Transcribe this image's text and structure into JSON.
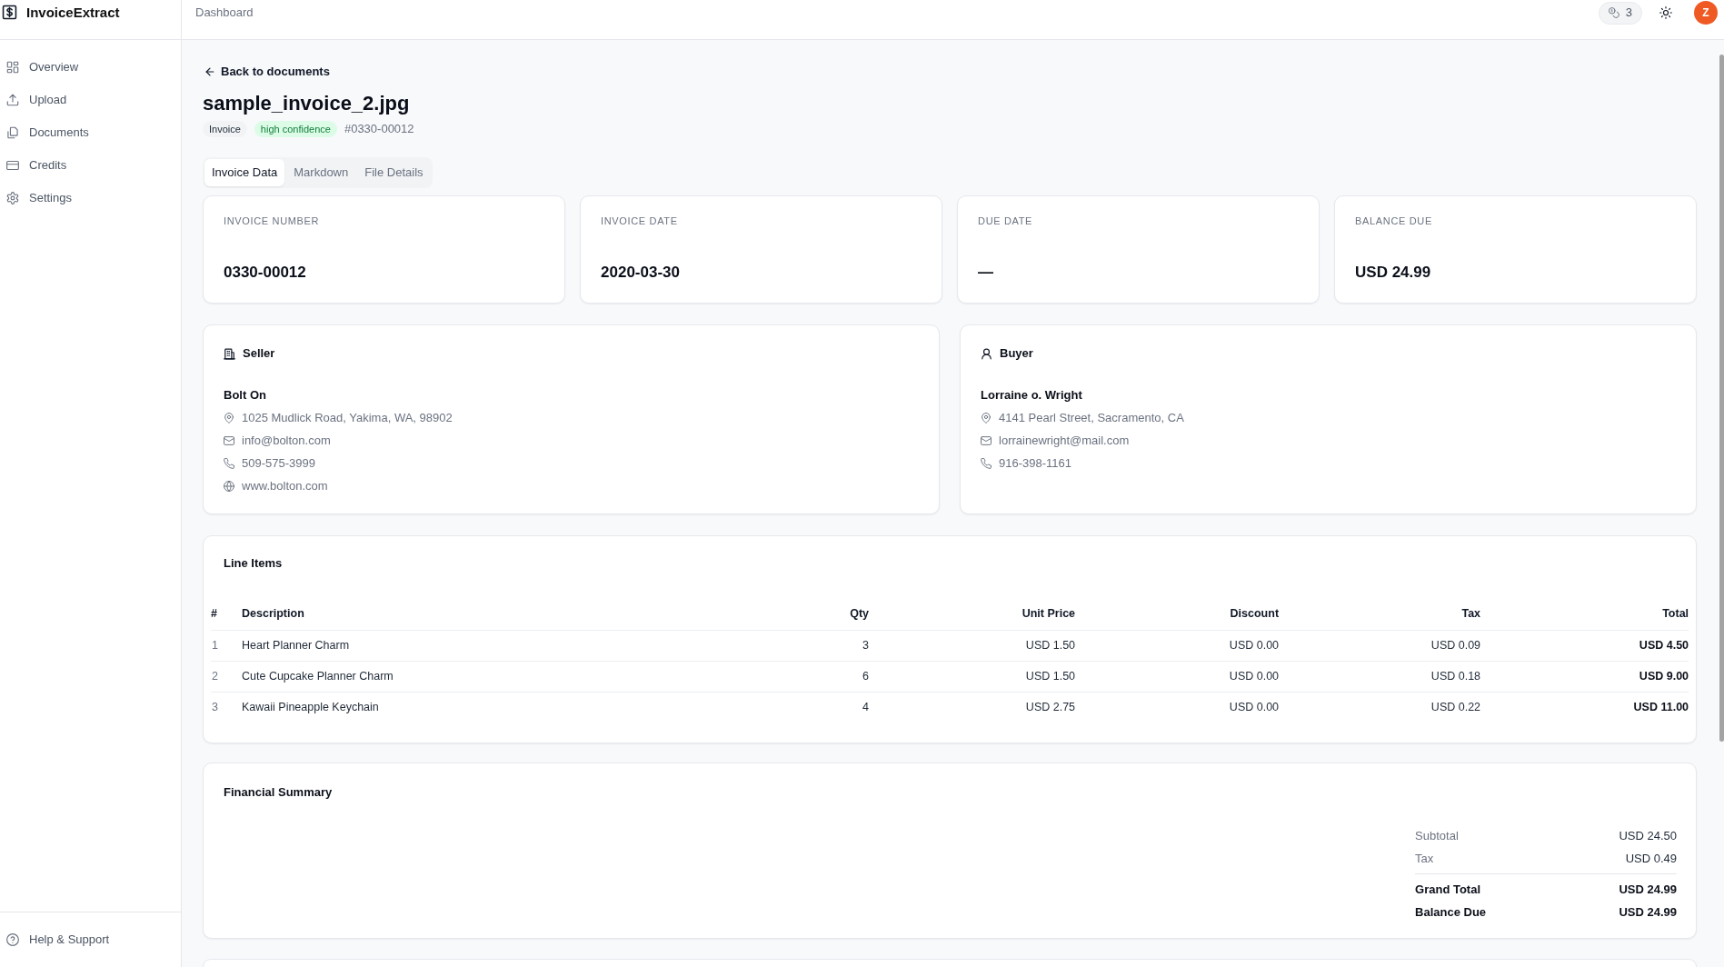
{
  "app": {
    "name": "InvoiceExtract"
  },
  "sidebar": {
    "items": [
      {
        "label": "Overview",
        "selected": false
      },
      {
        "label": "Upload",
        "selected": false
      },
      {
        "label": "Documents",
        "selected": false
      },
      {
        "label": "Credits",
        "selected": false
      },
      {
        "label": "Settings",
        "selected": false
      }
    ],
    "footer_link": "Help & Support"
  },
  "header": {
    "breadcrumb": "Dashboard",
    "credits": "3",
    "avatar_initial": "Z"
  },
  "document": {
    "back_link": "Back to documents",
    "title": "sample_invoice_2.jpg",
    "tags": [
      {
        "label": "Invoice",
        "kind": "type"
      },
      {
        "label": "high confidence",
        "kind": "confidence"
      }
    ],
    "reference": "#0330-00012"
  },
  "tabs": [
    {
      "label": "Invoice Data",
      "selected": true
    },
    {
      "label": "Markdown",
      "selected": false
    },
    {
      "label": "File Details",
      "selected": false
    }
  ],
  "summary_cards": [
    {
      "label": "INVOICE NUMBER",
      "value": "0330-00012"
    },
    {
      "label": "INVOICE DATE",
      "value": "2020-03-30"
    },
    {
      "label": "DUE DATE",
      "value": "—"
    },
    {
      "label": "BALANCE DUE",
      "value": "USD 24.99"
    }
  ],
  "parties": [
    {
      "kind": "seller",
      "title": "Seller",
      "name": "Bolt On",
      "details": [
        {
          "kind": "address",
          "text": "1025 Mudlick Road, Yakima, WA, 98902"
        },
        {
          "kind": "email",
          "text": "info@bolton.com"
        },
        {
          "kind": "phone",
          "text": "509-575-3999"
        },
        {
          "kind": "website",
          "text": "www.bolton.com"
        }
      ]
    },
    {
      "kind": "buyer",
      "title": "Buyer",
      "name": "Lorraine o. Wright",
      "details": [
        {
          "kind": "address",
          "text": "4141 Pearl Street, Sacramento, CA"
        },
        {
          "kind": "email",
          "text": "lorrainewright@mail.com"
        },
        {
          "kind": "phone",
          "text": "916-398-1161"
        }
      ]
    }
  ],
  "line_items": {
    "title": "Line Items",
    "columns": [
      "#",
      "Description",
      "Qty",
      "Unit Price",
      "Discount",
      "Tax",
      "Total"
    ],
    "rows": [
      [
        "1",
        "Heart Planner Charm",
        "3",
        "USD 1.50",
        "USD 0.00",
        "USD 0.09",
        "USD 4.50"
      ],
      [
        "2",
        "Cute Cupcake Planner Charm",
        "6",
        "USD 1.50",
        "USD 0.00",
        "USD 0.18",
        "USD 9.00"
      ],
      [
        "3",
        "Kawaii Pineapple Keychain",
        "4",
        "USD 2.75",
        "USD 0.00",
        "USD 0.22",
        "USD 11.00"
      ]
    ]
  },
  "financial_summary": {
    "title": "Financial Summary",
    "rows": [
      {
        "label": "Subtotal",
        "value": "USD 24.50",
        "kind": "line"
      },
      {
        "label": "Tax",
        "value": "USD 0.49",
        "kind": "line"
      },
      {
        "label": "Grand Total",
        "value": "USD 24.99",
        "kind": "total"
      },
      {
        "label": "Balance Due",
        "value": "USD 24.99",
        "kind": "total"
      }
    ]
  }
}
